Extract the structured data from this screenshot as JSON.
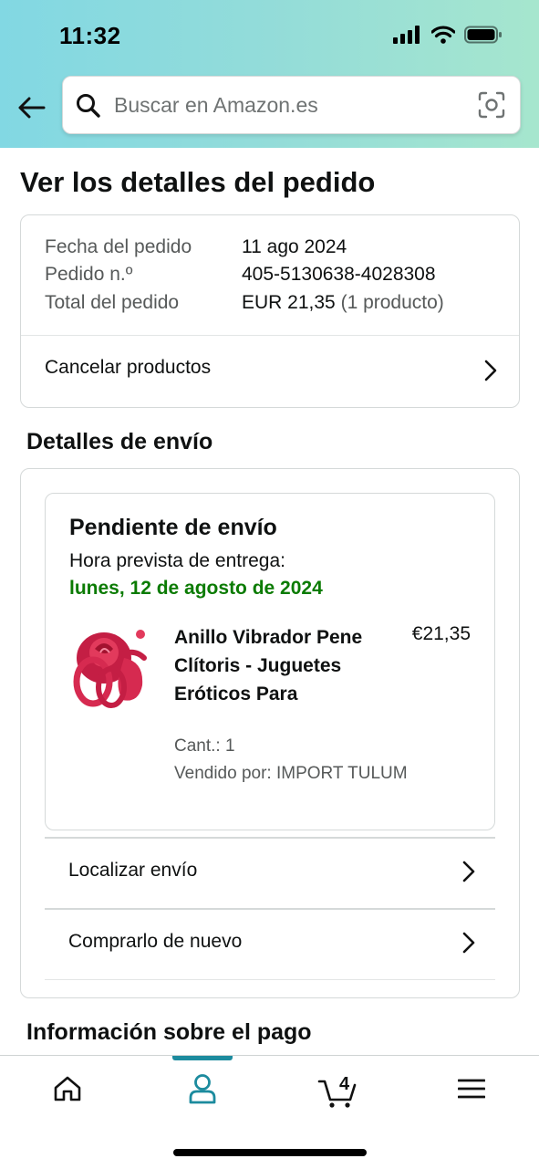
{
  "status_bar": {
    "time": "11:32"
  },
  "search": {
    "placeholder": "Buscar en Amazon.es"
  },
  "page": {
    "title": "Ver los detalles del pedido"
  },
  "order_summary": {
    "date_label": "Fecha del pedido",
    "date_value": "11 ago 2024",
    "number_label": "Pedido n.º",
    "number_value": "405-5130638-4028308",
    "total_label": "Total del pedido",
    "total_value": "EUR 21,35",
    "total_items": "(1 producto)",
    "cancel_label": "Cancelar productos"
  },
  "shipping": {
    "section_title": "Detalles de envío",
    "status_title": "Pendiente de envío",
    "eta_label": "Hora prevista de entrega:",
    "eta_date": "lunes, 12 de agosto de 2024",
    "product": {
      "title": "Anillo Vibrador Pene Clítoris - Juguetes Eróticos Para",
      "price": "€21,35",
      "quantity": "Cant.: 1",
      "seller": "Vendido por: IMPORT TULUM"
    },
    "track_label": "Localizar envío",
    "buy_again_label": "Comprarlo de nuevo"
  },
  "payment": {
    "section_title": "Información sobre el pago"
  },
  "tabbar": {
    "items": [
      "home-icon",
      "account-icon",
      "cart-icon",
      "menu-icon"
    ],
    "active": "account-icon",
    "cart_count": "4",
    "accent_color": "#1c8b9e"
  },
  "colors": {
    "delivery_green": "#0b7b03",
    "header_start": "#82d8e3",
    "header_end": "#a6e6ce"
  }
}
